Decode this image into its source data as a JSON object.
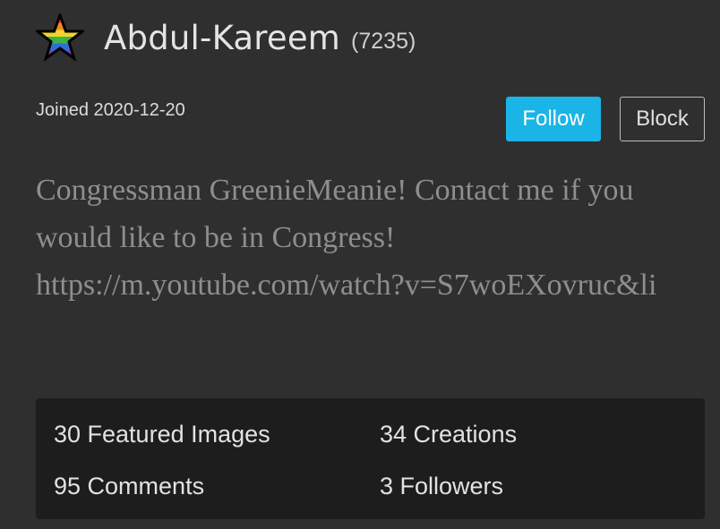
{
  "profile": {
    "avatar_icon": "rainbow-star-icon",
    "username": "Abdul-Kareem",
    "points": "(7235)",
    "joined": "Joined 2020-12-20",
    "bio": "Congressman GreenieMeanie! Contact me if you would like to be in Congress! https://m.youtube.com/watch?v=S7woEXovruc&li"
  },
  "actions": {
    "follow_label": "Follow",
    "block_label": "Block"
  },
  "stats": {
    "featured_images": "30 Featured Images",
    "creations": "34 Creations",
    "comments": "95 Comments",
    "followers": "3 Followers"
  },
  "colors": {
    "background": "#2f2f2f",
    "panel": "#1d1d1d",
    "accent": "#1ab5e6",
    "bio_text": "#8e8e8e"
  }
}
